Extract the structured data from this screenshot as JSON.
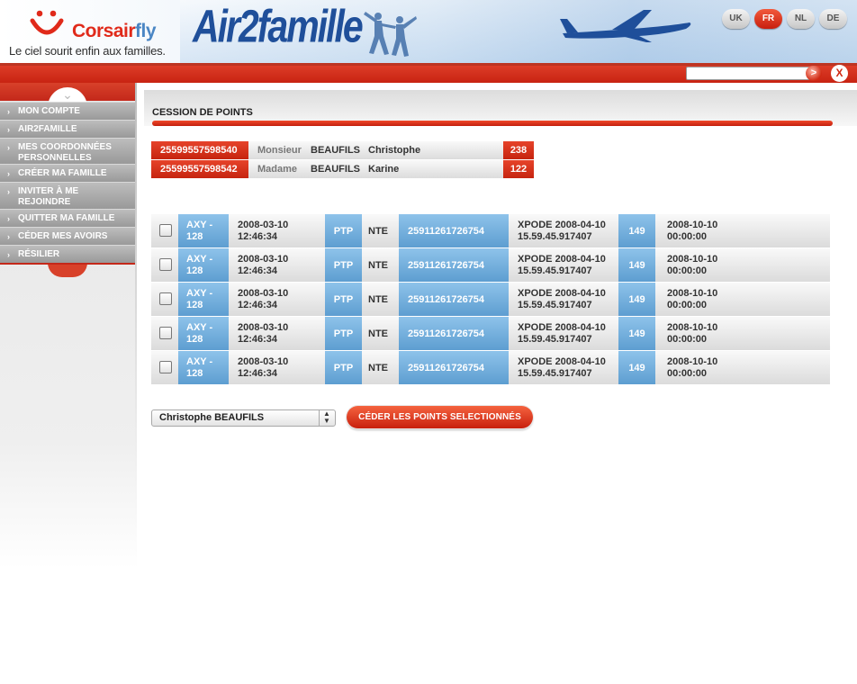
{
  "header": {
    "brand_name_1": "Corsair",
    "brand_name_2": "fly",
    "tagline": "Le ciel sourit enfin aux familles.",
    "program_name": "Air2famille",
    "languages": [
      {
        "code": "UK",
        "active": false
      },
      {
        "code": "FR",
        "active": true
      },
      {
        "code": "NL",
        "active": false
      },
      {
        "code": "DE",
        "active": false
      }
    ],
    "search_go": ">",
    "close": "X"
  },
  "sidebar": {
    "items": [
      {
        "label": "MON COMPTE"
      },
      {
        "label": "AIR2FAMILLE"
      },
      {
        "label": "MES COORDONNÉES PERSONNELLES"
      },
      {
        "label": "CRÉER MA FAMILLE"
      },
      {
        "label": "INVITER À ME REJOINDRE"
      },
      {
        "label": "QUITTER MA FAMILLE"
      },
      {
        "label": "CÉDER MES AVOIRS"
      },
      {
        "label": "RÉSILIER"
      }
    ]
  },
  "main": {
    "title": "CESSION DE POINTS",
    "members": [
      {
        "card": "25599557598540",
        "civility": "Monsieur",
        "last_name": "BEAUFILS",
        "first_name": "Christophe",
        "points": "238"
      },
      {
        "card": "25599557598542",
        "civility": "Madame",
        "last_name": "BEAUFILS",
        "first_name": "Karine",
        "points": "122"
      }
    ],
    "rows": [
      {
        "code": "AXY - 128",
        "date": "2008-03-10 12:46:34",
        "type": "PTP",
        "station": "NTE",
        "card": "25911261726754",
        "ref": "XPODE 2008-04-10 15.59.45.917407",
        "points": "149",
        "expiry": "2008-10-10 00:00:00"
      },
      {
        "code": "AXY - 128",
        "date": "2008-03-10 12:46:34",
        "type": "PTP",
        "station": "NTE",
        "card": "25911261726754",
        "ref": "XPODE 2008-04-10 15.59.45.917407",
        "points": "149",
        "expiry": "2008-10-10 00:00:00"
      },
      {
        "code": "AXY - 128",
        "date": "2008-03-10 12:46:34",
        "type": "PTP",
        "station": "NTE",
        "card": "25911261726754",
        "ref": "XPODE 2008-04-10 15.59.45.917407",
        "points": "149",
        "expiry": "2008-10-10 00:00:00"
      },
      {
        "code": "AXY - 128",
        "date": "2008-03-10 12:46:34",
        "type": "PTP",
        "station": "NTE",
        "card": "25911261726754",
        "ref": "XPODE 2008-04-10 15.59.45.917407",
        "points": "149",
        "expiry": "2008-10-10 00:00:00"
      },
      {
        "code": "AXY - 128",
        "date": "2008-03-10 12:46:34",
        "type": "PTP",
        "station": "NTE",
        "card": "25911261726754",
        "ref": "XPODE 2008-04-10 15.59.45.917407",
        "points": "149",
        "expiry": "2008-10-10 00:00:00"
      }
    ],
    "recipient_select": "Christophe BEAUFILS",
    "submit_label": "CÉDER LES POINTS SELECTIONNÉS"
  },
  "colors": {
    "accent_red": "#d0301a",
    "accent_blue": "#6ba8d8",
    "brand_blue": "#1f4f9a"
  }
}
